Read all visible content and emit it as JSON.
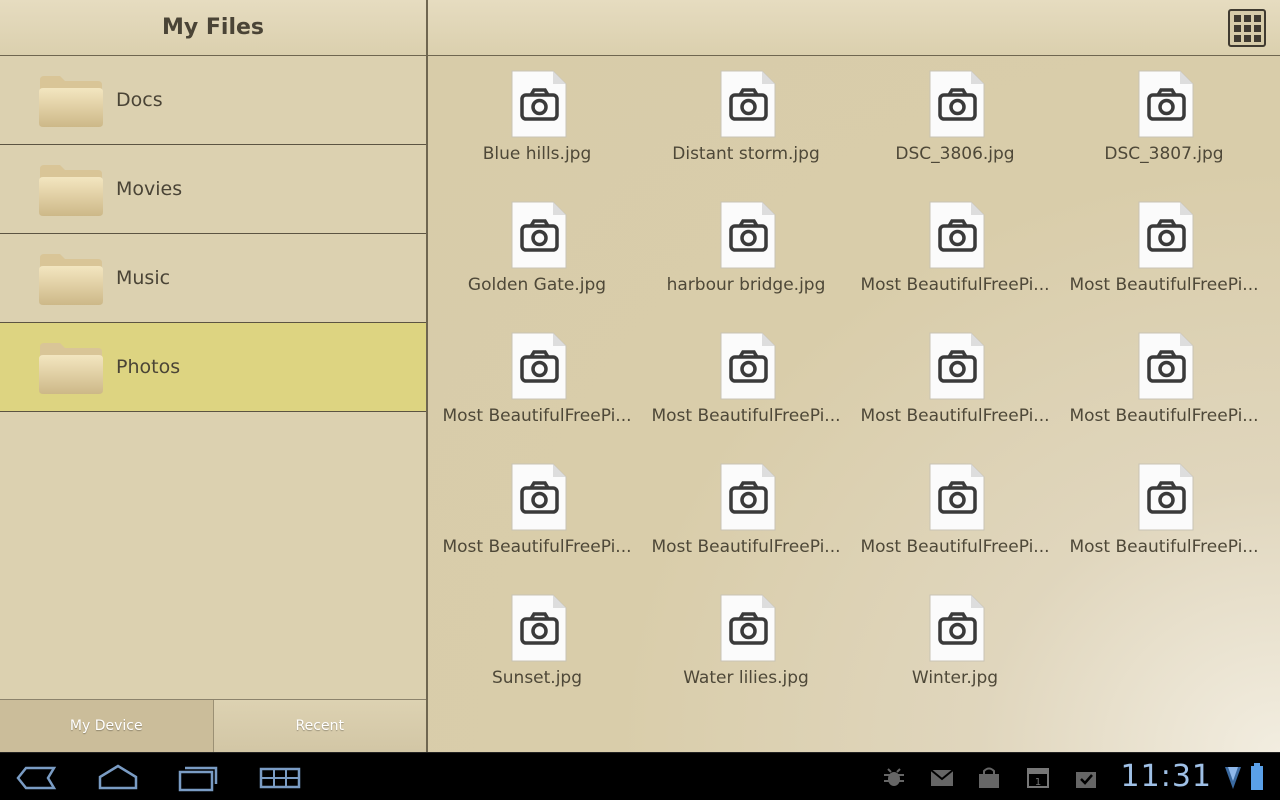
{
  "app": {
    "title": "My Files"
  },
  "folders": [
    {
      "label": "Docs",
      "selected": false
    },
    {
      "label": "Movies",
      "selected": false
    },
    {
      "label": "Music",
      "selected": false
    },
    {
      "label": "Photos",
      "selected": true
    }
  ],
  "bottom_tabs": [
    {
      "label": "My Device",
      "active": true
    },
    {
      "label": "Recent",
      "active": false
    }
  ],
  "files": [
    "Blue hills.jpg",
    "Distant storm.jpg",
    "DSC_3806.jpg",
    "DSC_3807.jpg",
    "Golden Gate.jpg",
    "harbour bridge.jpg",
    "Most BeautifulFreePi...",
    "Most BeautifulFreePi...",
    "Most BeautifulFreePi...",
    "Most BeautifulFreePi...",
    "Most BeautifulFreePi...",
    "Most BeautifulFreePi...",
    "Most BeautifulFreePi...",
    "Most BeautifulFreePi...",
    "Most BeautifulFreePi...",
    "Most BeautifulFreePi...",
    "Sunset.jpg",
    "Water lilies.jpg",
    "Winter.jpg"
  ],
  "icons": {
    "view_toggle": "grid-view-icon",
    "folder": "folder-icon",
    "file": "image-file-icon"
  },
  "system_bar": {
    "clock": "11:31",
    "nav": [
      "back-icon",
      "home-icon",
      "recent-apps-icon",
      "screenshot-icon"
    ],
    "status": [
      "usb-debug-icon",
      "gmail-icon",
      "store-icon",
      "calendar-icon",
      "tasks-icon",
      "wifi-icon",
      "battery-icon"
    ]
  },
  "colors": {
    "panel_bg": "#dcd1b0",
    "selected_row": "#ddd481",
    "text": "#4a4436",
    "clock": "#9fc0e6"
  }
}
